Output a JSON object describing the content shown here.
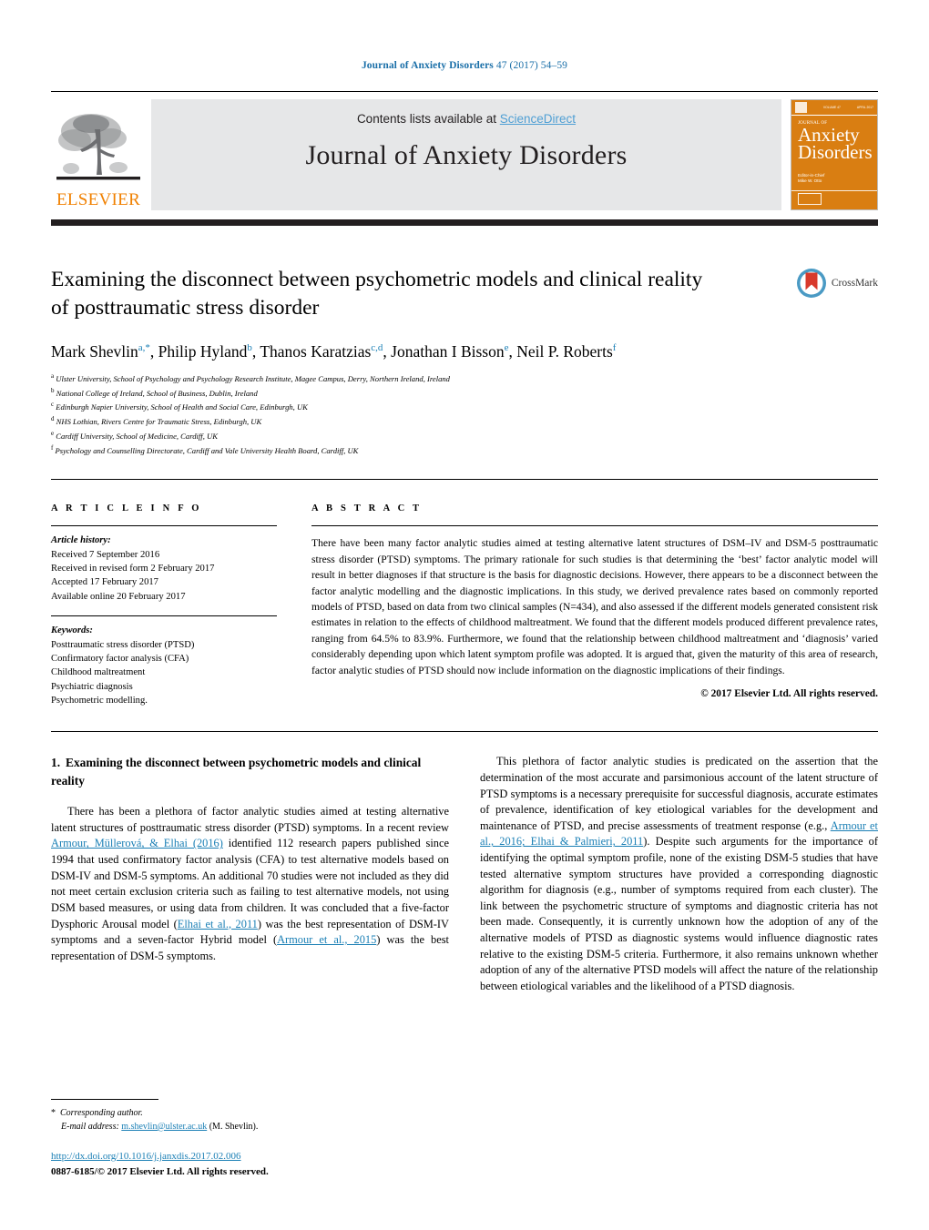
{
  "running_head": {
    "journal": "Journal of Anxiety Disorders",
    "volume_pages": "47 (2017) 54–59"
  },
  "banner": {
    "contents_prefix": "Contents lists available at ",
    "sciencedirect": "ScienceDirect",
    "journal_name": "Journal of Anxiety Disorders",
    "publisher": "ELSEVIER",
    "cover": {
      "small_line": "JOURNAL OF",
      "word1": "Anxiety",
      "word2": "Disorders",
      "editors": "Editor-in-Chief\nMike W. Otto",
      "top_left": "ISSN 0887-6185",
      "top_mid": "VOLUME 47",
      "top_right": "APRIL 2017"
    }
  },
  "article": {
    "title": "Examining the disconnect between psychometric models and clinical reality of posttraumatic stress disorder",
    "crossmark_label": "CrossMark",
    "authors": [
      {
        "name": "Mark Shevlin",
        "marks": "a,*"
      },
      {
        "name": "Philip Hyland",
        "marks": "b"
      },
      {
        "name": "Thanos Karatzias",
        "marks": "c,d"
      },
      {
        "name": "Jonathan I Bisson",
        "marks": "e"
      },
      {
        "name": "Neil P. Roberts",
        "marks": "f"
      }
    ],
    "affiliations": [
      {
        "mark": "a",
        "text": "Ulster University, School of Psychology and Psychology Research Institute, Magee Campus, Derry, Northern Ireland, Ireland"
      },
      {
        "mark": "b",
        "text": "National College of Ireland, School of Business, Dublin, Ireland"
      },
      {
        "mark": "c",
        "text": "Edinburgh Napier University, School of Health and Social Care, Edinburgh, UK"
      },
      {
        "mark": "d",
        "text": "NHS Lothian, Rivers Centre for Traumatic Stress, Edinburgh, UK"
      },
      {
        "mark": "e",
        "text": "Cardiff University, School of Medicine, Cardiff, UK"
      },
      {
        "mark": "f",
        "text": "Psychology and Counselling Directorate, Cardiff and Vale University Health Board, Cardiff, UK"
      }
    ]
  },
  "article_info": {
    "heading": "A R T I C L E   I N F O",
    "history_label": "Article history:",
    "history": [
      "Received 7 September 2016",
      "Received in revised form 2 February 2017",
      "Accepted 17 February 2017",
      "Available online 20 February 2017"
    ],
    "keywords_label": "Keywords:",
    "keywords": [
      "Posttraumatic stress disorder (PTSD)",
      "Confirmatory factor analysis (CFA)",
      "Childhood maltreatment",
      "Psychiatric diagnosis",
      "Psychometric modelling."
    ]
  },
  "abstract": {
    "heading": "A B S T R A C T",
    "text": "There have been many factor analytic studies aimed at testing alternative latent structures of DSM–IV and DSM-5 posttraumatic stress disorder (PTSD) symptoms. The primary rationale for such studies is that determining the ‘best’ factor analytic model will result in better diagnoses if that structure is the basis for diagnostic decisions. However, there appears to be a disconnect between the factor analytic modelling and the diagnostic implications. In this study, we derived prevalence rates based on commonly reported models of PTSD, based on data from two clinical samples (N=434), and also assessed if the different models generated consistent risk estimates in relation to the effects of childhood maltreatment. We found that the different models produced different prevalence rates, ranging from 64.5% to 83.9%. Furthermore, we found that the relationship between childhood maltreatment and ‘diagnosis’ varied considerably depending upon which latent symptom profile was adopted. It is argued that, given the maturity of this area of research, factor analytic studies of PTSD should now include information on the diagnostic implications of their findings.",
    "copyright": "© 2017 Elsevier Ltd. All rights reserved."
  },
  "section1": {
    "number": "1.",
    "heading": "Examining the disconnect between psychometric models and clinical reality",
    "para1_a": "There has been a plethora of factor analytic studies aimed at testing alternative latent structures of posttraumatic stress disorder (PTSD) symptoms. In a recent review ",
    "para1_cite1": "Armour, Müllerová, & Elhai (2016)",
    "para1_b": " identified 112 research papers published since 1994 that used confirmatory factor analysis (CFA) to test alternative models based on DSM-IV and DSM-5 symptoms. An additional 70 studies were not included as they did not meet certain exclusion criteria such as failing to test alternative models, not using DSM based measures, or using data from children. It was concluded that a five-factor Dysphoric Arousal model (",
    "para1_cite2": "Elhai et al., 2011",
    "para1_c": ") was the best representation of DSM-IV symptoms and a seven-factor Hybrid model (",
    "para1_cite3": "Armour et al., 2015",
    "para1_d": ") was the best representation of DSM-5 symptoms."
  },
  "section1_right": {
    "para2_a": "This plethora of factor analytic studies is predicated on the assertion that the determination of the most accurate and parsimonious account of the latent structure of PTSD symptoms is a necessary prerequisite for successful diagnosis, accurate estimates of prevalence, identification of key etiological variables for the development and maintenance of PTSD, and precise assessments of treatment response (e.g., ",
    "para2_cite1": "Armour et al., 2016; Elhai & Palmieri, 2011",
    "para2_b": "). Despite such arguments for the importance of identifying the optimal symptom profile, none of the existing DSM-5 studies that have tested alternative symptom structures have provided a corresponding diagnostic algorithm for diagnosis (e.g., number of symptoms required from each cluster). The link between the psychometric structure of symptoms and diagnostic criteria has not been made. Consequently, it is currently unknown how the adoption of any of the alternative models of PTSD as diagnostic systems would influence diagnostic rates relative to the existing DSM-5 criteria. Furthermore, it also remains unknown whether adoption of any of the alternative PTSD models will affect the nature of the relationship between etiological variables and the likelihood of a PTSD diagnosis."
  },
  "footer": {
    "corresponding_star": "*",
    "corresponding_label": "Corresponding author.",
    "email_label": "E-mail address:",
    "email": "m.shevlin@ulster.ac.uk",
    "email_suffix": " (M. Shevlin).",
    "doi": "http://dx.doi.org/10.1016/j.janxdis.2017.02.006",
    "issn": "0887-6185/© 2017 Elsevier Ltd. All rights reserved."
  },
  "colors": {
    "link_blue": "#1a7fb5",
    "sciencedirect_blue": "#4f9fd4",
    "elsevier_orange": "#f08000",
    "cover_orange": "#d97e12",
    "banner_grey": "#e6e7e8"
  }
}
